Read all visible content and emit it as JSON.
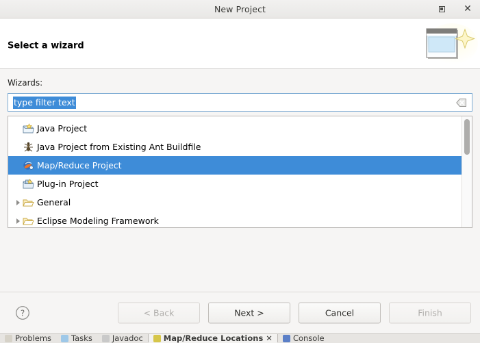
{
  "window": {
    "title": "New Project",
    "maximize_label": "Maximize",
    "close_label": "Close"
  },
  "header": {
    "title": "Select a wizard",
    "icon": "new-project-wizard-icon"
  },
  "form": {
    "wizards_label": "Wizards:",
    "filter": {
      "value": "type filter text",
      "placeholder": "type filter text",
      "selected": true,
      "clear_icon": "clear-filter-icon"
    }
  },
  "list": {
    "items": [
      {
        "label": "Java Project",
        "icon": "java-project-icon",
        "expandable": false,
        "selected": false
      },
      {
        "label": "Java Project from Existing Ant Buildfile",
        "icon": "ant-buildfile-icon",
        "expandable": false,
        "selected": false
      },
      {
        "label": "Map/Reduce Project",
        "icon": "map-reduce-project-icon",
        "expandable": false,
        "selected": true
      },
      {
        "label": "Plug-in Project",
        "icon": "plugin-project-icon",
        "expandable": false,
        "selected": false
      },
      {
        "label": "General",
        "icon": "folder-icon",
        "expandable": true,
        "selected": false
      },
      {
        "label": "Eclipse Modeling Framework",
        "icon": "folder-icon",
        "expandable": true,
        "selected": false
      }
    ],
    "selection_color": "#3e8cd8"
  },
  "footer": {
    "help_icon": "help-icon",
    "buttons": [
      {
        "label": "< Back",
        "enabled": false,
        "name": "back-button"
      },
      {
        "label": "Next >",
        "enabled": true,
        "name": "next-button"
      },
      {
        "label": "Cancel",
        "enabled": true,
        "name": "cancel-button"
      },
      {
        "label": "Finish",
        "enabled": false,
        "name": "finish-button"
      }
    ]
  },
  "background_tabs": [
    {
      "label": "Problems",
      "active": false,
      "color": "#d6d2c8"
    },
    {
      "label": "Tasks",
      "active": false,
      "color": "#9ec8e8"
    },
    {
      "label": "Javadoc",
      "active": false,
      "color": "#c9c9c9"
    },
    {
      "label": "Map/Reduce Locations",
      "active": true,
      "color": "#d6c64a"
    },
    {
      "label": "Console",
      "active": false,
      "color": "#5b7fc7"
    }
  ]
}
